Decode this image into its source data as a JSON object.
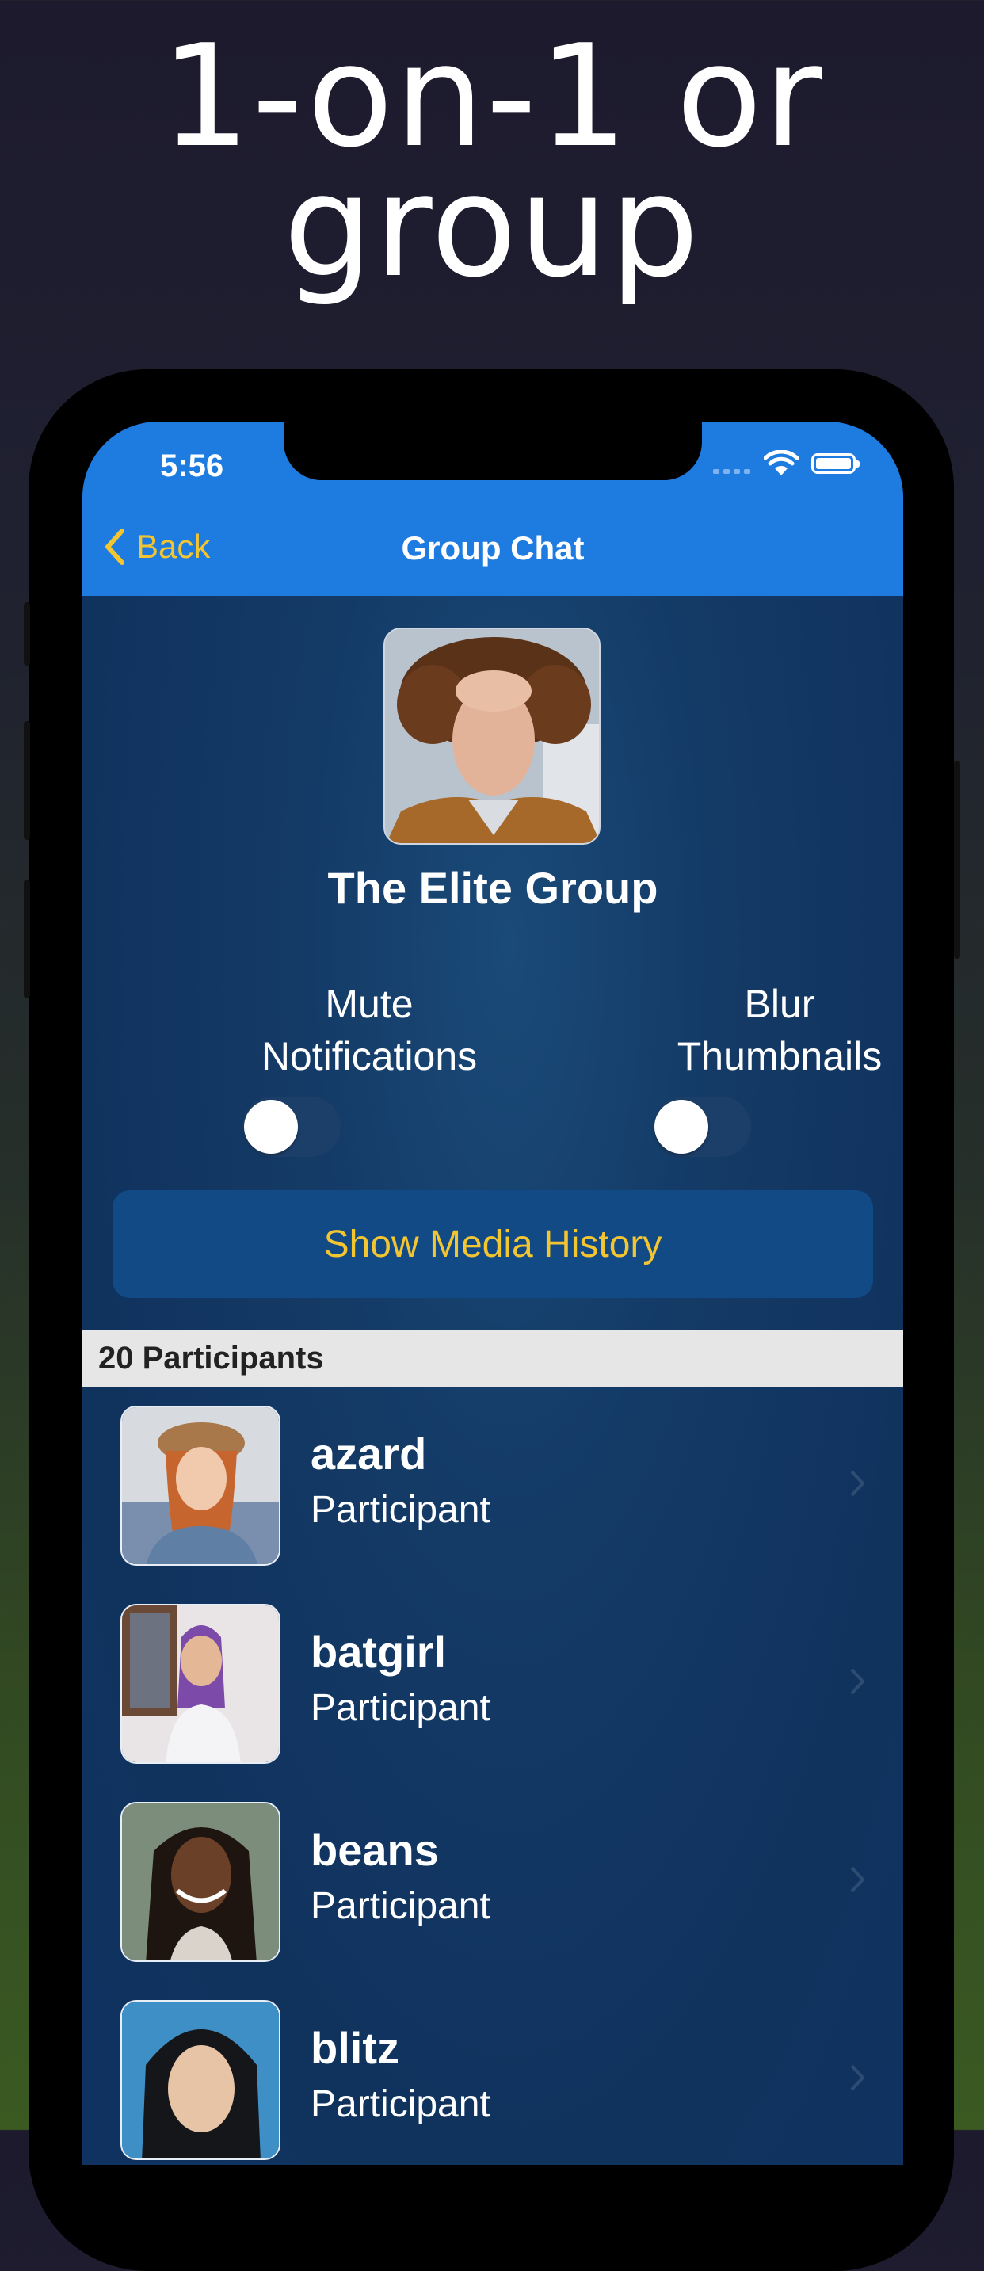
{
  "headline": {
    "line1": "1-on-1 or",
    "line2": "group"
  },
  "status_bar": {
    "time": "5:56"
  },
  "nav": {
    "back_label": "Back",
    "title": "Group Chat"
  },
  "group": {
    "name": "The Elite Group"
  },
  "settings": {
    "mute": {
      "line1": "Mute",
      "line2": "Notifications",
      "on": false
    },
    "blur": {
      "line1": "Blur",
      "line2": "Thumbnails",
      "on": false
    }
  },
  "media_button": {
    "label": "Show Media History"
  },
  "participants": {
    "header": "20 Participants",
    "items": [
      {
        "name": "azard",
        "role": "Participant"
      },
      {
        "name": "batgirl",
        "role": "Participant"
      },
      {
        "name": "beans",
        "role": "Participant"
      },
      {
        "name": "blitz",
        "role": "Participant"
      }
    ]
  },
  "colors": {
    "accent": "#f2c531",
    "nav_bar": "#1e7ce0",
    "screen_bg": "#10335e",
    "button_bg": "#124a86"
  }
}
